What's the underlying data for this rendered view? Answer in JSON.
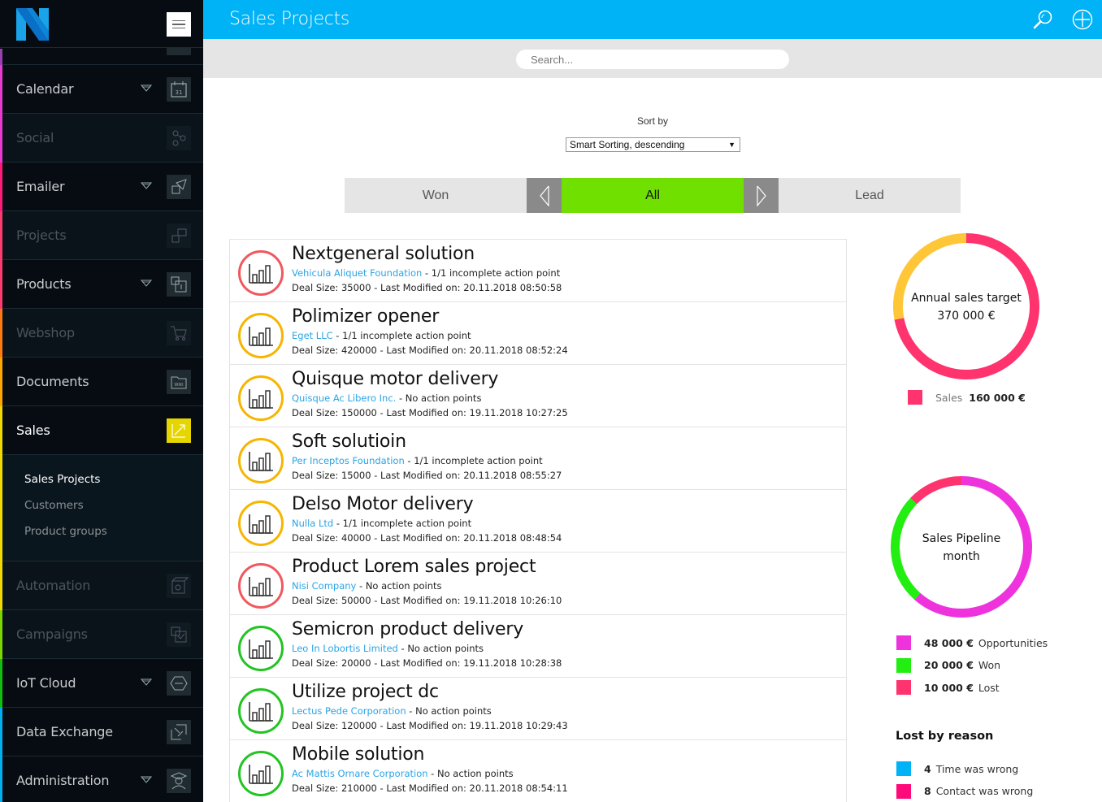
{
  "app": {
    "title": "Sales Projects",
    "colors": {
      "header": "#00b2f6",
      "sidebar": "#060c12",
      "active_filter": "#70e000",
      "active_nav_icon": "#e5d600"
    }
  },
  "sidebar": {
    "menu_icon": "hamburger-icon",
    "items": [
      {
        "label": "Calendar",
        "icon": "calendar-icon",
        "has_caret": true,
        "state": "normal",
        "stripe": "#e83ad0"
      },
      {
        "label": "Social",
        "icon": "share-icon",
        "has_caret": false,
        "state": "dim",
        "stripe": "#e83ad0"
      },
      {
        "label": "Emailer",
        "icon": "send-mail-icon",
        "has_caret": true,
        "state": "normal",
        "stripe": "#ff1a7a"
      },
      {
        "label": "Projects",
        "icon": "projects-icon",
        "has_caret": false,
        "state": "dim",
        "stripe": "#ff3a6e"
      },
      {
        "label": "Products",
        "icon": "product-info-icon",
        "has_caret": true,
        "state": "normal",
        "stripe": "#ff3a6e"
      },
      {
        "label": "Webshop",
        "icon": "cart-icon",
        "has_caret": false,
        "state": "dim",
        "stripe": "#ff7a10"
      },
      {
        "label": "Documents",
        "icon": "wiki-folder-icon",
        "has_caret": false,
        "state": "normal",
        "stripe": "#ffa500"
      },
      {
        "label": "Sales",
        "icon": "trend-arrow-icon",
        "has_caret": false,
        "state": "active",
        "stripe": "#f0d800"
      }
    ],
    "sales_submenu": [
      {
        "label": "Sales Projects",
        "current": true
      },
      {
        "label": "Customers",
        "current": false
      },
      {
        "label": "Product groups",
        "current": false
      }
    ],
    "items_after": [
      {
        "label": "Automation",
        "icon": "automation-icon",
        "has_caret": false,
        "state": "dim",
        "stripe": "#f0d800"
      },
      {
        "label": "Campaigns",
        "icon": "campaign-icon",
        "has_caret": false,
        "state": "dim",
        "stripe": "#7ad800"
      },
      {
        "label": "IoT Cloud",
        "icon": "iot-network-icon",
        "has_caret": true,
        "state": "normal",
        "stripe": "#10c010"
      },
      {
        "label": "Data Exchange",
        "icon": "data-exchange-icon",
        "has_caret": false,
        "state": "normal",
        "stripe": "#00aef0"
      },
      {
        "label": "Administration",
        "icon": "admin-user-icon",
        "has_caret": true,
        "state": "normal",
        "stripe": "#00aef0"
      }
    ]
  },
  "header": {
    "title": "Sales Projects",
    "search_icon": "search-icon",
    "add_icon": "add-circle-icon"
  },
  "search": {
    "placeholder": "Search...",
    "value": ""
  },
  "sort": {
    "label": "Sort by",
    "selected": "Smart Sorting, descending"
  },
  "filters": {
    "tabs": [
      {
        "label": "Won",
        "active": false
      },
      {
        "label": "All",
        "active": true
      },
      {
        "label": "Lead",
        "active": false
      }
    ]
  },
  "projects": [
    {
      "name": "Nextgeneral solution",
      "company": "Vehicula Aliquet Foundation",
      "actions": "1/1 incomplete action point",
      "deal_size": "35000",
      "modified": "20.11.2018 08:50:58",
      "status_color": "#f0585f"
    },
    {
      "name": "Polimizer opener",
      "company": "Eget LLC",
      "actions": "1/1 incomplete action point",
      "deal_size": "420000",
      "modified": "20.11.2018 08:52:24",
      "status_color": "#f7b500"
    },
    {
      "name": "Quisque motor delivery",
      "company": "Quisque Ac Libero Inc.",
      "actions": "No action points",
      "deal_size": "150000",
      "modified": "19.11.2018 10:27:25",
      "status_color": "#f7b500"
    },
    {
      "name": "Soft solutioin",
      "company": "Per Inceptos Foundation",
      "actions": "1/1 incomplete action point",
      "deal_size": "15000",
      "modified": "20.11.2018 08:55:27",
      "status_color": "#f7b500"
    },
    {
      "name": "Delso Motor delivery",
      "company": "Nulla Ltd",
      "actions": "1/1 incomplete action point",
      "deal_size": "40000",
      "modified": "20.11.2018 08:48:54",
      "status_color": "#f7b500"
    },
    {
      "name": "Product Lorem sales project",
      "company": "Nisi Company",
      "actions": "No action points",
      "deal_size": "50000",
      "modified": "19.11.2018 10:26:10",
      "status_color": "#f0585f"
    },
    {
      "name": "Semicron product delivery",
      "company": "Leo In Lobortis Limited",
      "actions": "No action points",
      "deal_size": "20000",
      "modified": "19.11.2018 10:28:38",
      "status_color": "#22c422"
    },
    {
      "name": "Utilize project dc",
      "company": "Lectus Pede Corporation",
      "actions": "No action points",
      "deal_size": "120000",
      "modified": "19.11.2018 10:29:43",
      "status_color": "#22c422"
    },
    {
      "name": "Mobile solution",
      "company": "Ac Mattis Ornare Corporation",
      "actions": "No action points",
      "deal_size": "210000",
      "modified": "20.11.2018 08:54:11",
      "status_color": "#22c422"
    }
  ],
  "labels": {
    "deal_size_prefix": "Deal Size: ",
    "modified_prefix": " - Last Modified on: ",
    "sep": " - "
  },
  "widgets": {
    "annual": {
      "title": "Annual sales target",
      "value": "370 000 €",
      "target": 370000,
      "sales": 160000,
      "legend": {
        "label": "Sales",
        "value": "160 000 €",
        "color": "#ff336e"
      },
      "remaining_color": "#ffc638"
    },
    "pipeline": {
      "title_line1": "Sales Pipeline",
      "title_line2": "month",
      "segments": [
        {
          "value_num": 48000,
          "value": "48 000 €",
          "label": "Opportunities",
          "color": "#ee33dd"
        },
        {
          "value_num": 20000,
          "value": "20 000 €",
          "label": "Won",
          "color": "#22ee11"
        },
        {
          "value_num": 10000,
          "value": "10 000 €",
          "label": "Lost",
          "color": "#ff336e"
        }
      ]
    },
    "lost_by_reason": {
      "title": "Lost by reason",
      "items": [
        {
          "count": "4",
          "label": "Time was wrong",
          "color": "#00b2f6"
        },
        {
          "count": "8",
          "label": "Contact was wrong",
          "color": "#ff0a7a"
        }
      ]
    }
  }
}
